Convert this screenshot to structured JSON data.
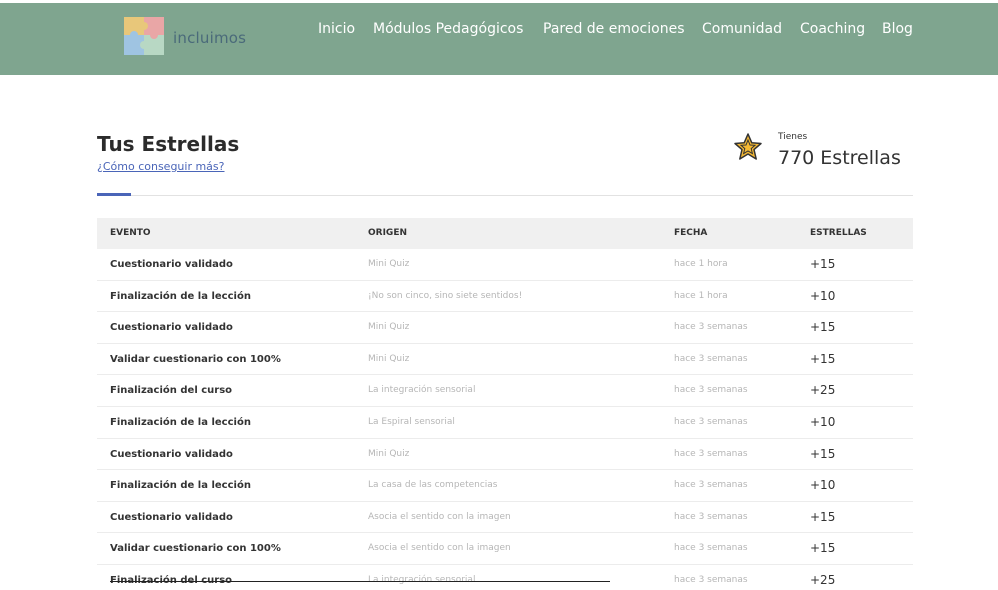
{
  "header": {
    "brand": "incluimos",
    "background_color": "#7fa58f",
    "nav": [
      {
        "label": "Inicio"
      },
      {
        "label": "Módulos Pedagógicos"
      },
      {
        "label": "Pared de emociones"
      },
      {
        "label": "Comunidad"
      },
      {
        "label": "Coaching"
      },
      {
        "label": "Blog"
      }
    ]
  },
  "main": {
    "title": "Tus Estrellas",
    "how_link": "¿Cómo conseguir más?",
    "star_icon": "star-icon",
    "tienes_label": "Tienes",
    "stars_total": "770 Estrellas",
    "accent_color": "#4a65b8"
  },
  "table": {
    "headers": {
      "evento": "EVENTO",
      "origen": "ORIGEN",
      "fecha": "FECHA",
      "estrellas": "ESTRELLAS"
    },
    "rows": [
      {
        "evento": "Cuestionario validado",
        "origen": "Mini Quiz",
        "fecha": "hace 1 hora",
        "estrellas": "+15"
      },
      {
        "evento": "Finalización de la lección",
        "origen": "¡No son cinco, sino siete sentidos!",
        "fecha": "hace 1 hora",
        "estrellas": "+10"
      },
      {
        "evento": "Cuestionario validado",
        "origen": "Mini Quiz",
        "fecha": "hace 3 semanas",
        "estrellas": "+15"
      },
      {
        "evento": "Validar cuestionario con 100%",
        "origen": "Mini Quiz",
        "fecha": "hace 3 semanas",
        "estrellas": "+15"
      },
      {
        "evento": "Finalización del curso",
        "origen": "La integración sensorial",
        "fecha": "hace 3 semanas",
        "estrellas": "+25"
      },
      {
        "evento": "Finalización de la lección",
        "origen": "La Espiral sensorial",
        "fecha": "hace 3 semanas",
        "estrellas": "+10"
      },
      {
        "evento": "Cuestionario validado",
        "origen": "Mini Quiz",
        "fecha": "hace 3 semanas",
        "estrellas": "+15"
      },
      {
        "evento": "Finalización de la lección",
        "origen": "La casa de las competencias",
        "fecha": "hace 3 semanas",
        "estrellas": "+10"
      },
      {
        "evento": "Cuestionario validado",
        "origen": "Asocia el sentido con la imagen",
        "fecha": "hace 3 semanas",
        "estrellas": "+15"
      },
      {
        "evento": "Validar cuestionario con 100%",
        "origen": "Asocia el sentido con la imagen",
        "fecha": "hace 3 semanas",
        "estrellas": "+15"
      },
      {
        "evento": "Finalización del curso",
        "origen": "La integración sensorial",
        "fecha": "hace 3 semanas",
        "estrellas": "+25"
      }
    ]
  }
}
